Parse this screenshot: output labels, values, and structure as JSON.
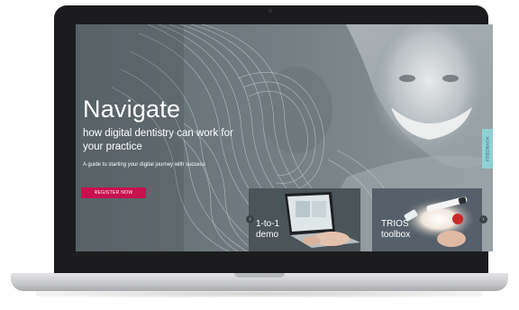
{
  "hero": {
    "headline": "Navigate",
    "subhead": "how digital dentistry can work for your practice",
    "tagline": "A guide to starting your digital journey with success",
    "register_label": "REGISTER NOW"
  },
  "feedback_label": "FEEDBACK",
  "cards": [
    {
      "label": "1-to-1\ndemo"
    },
    {
      "label": "TRIOS\ntoolbox"
    }
  ],
  "carousel": {
    "prev_icon": "chevron-left-icon",
    "next_icon": "chevron-right-icon"
  },
  "colors": {
    "accent": "#c8104e",
    "feedback": "#8fd1d6",
    "screen_bg": "#6f7a7f",
    "laptop_frame": "#1c1c1e"
  }
}
